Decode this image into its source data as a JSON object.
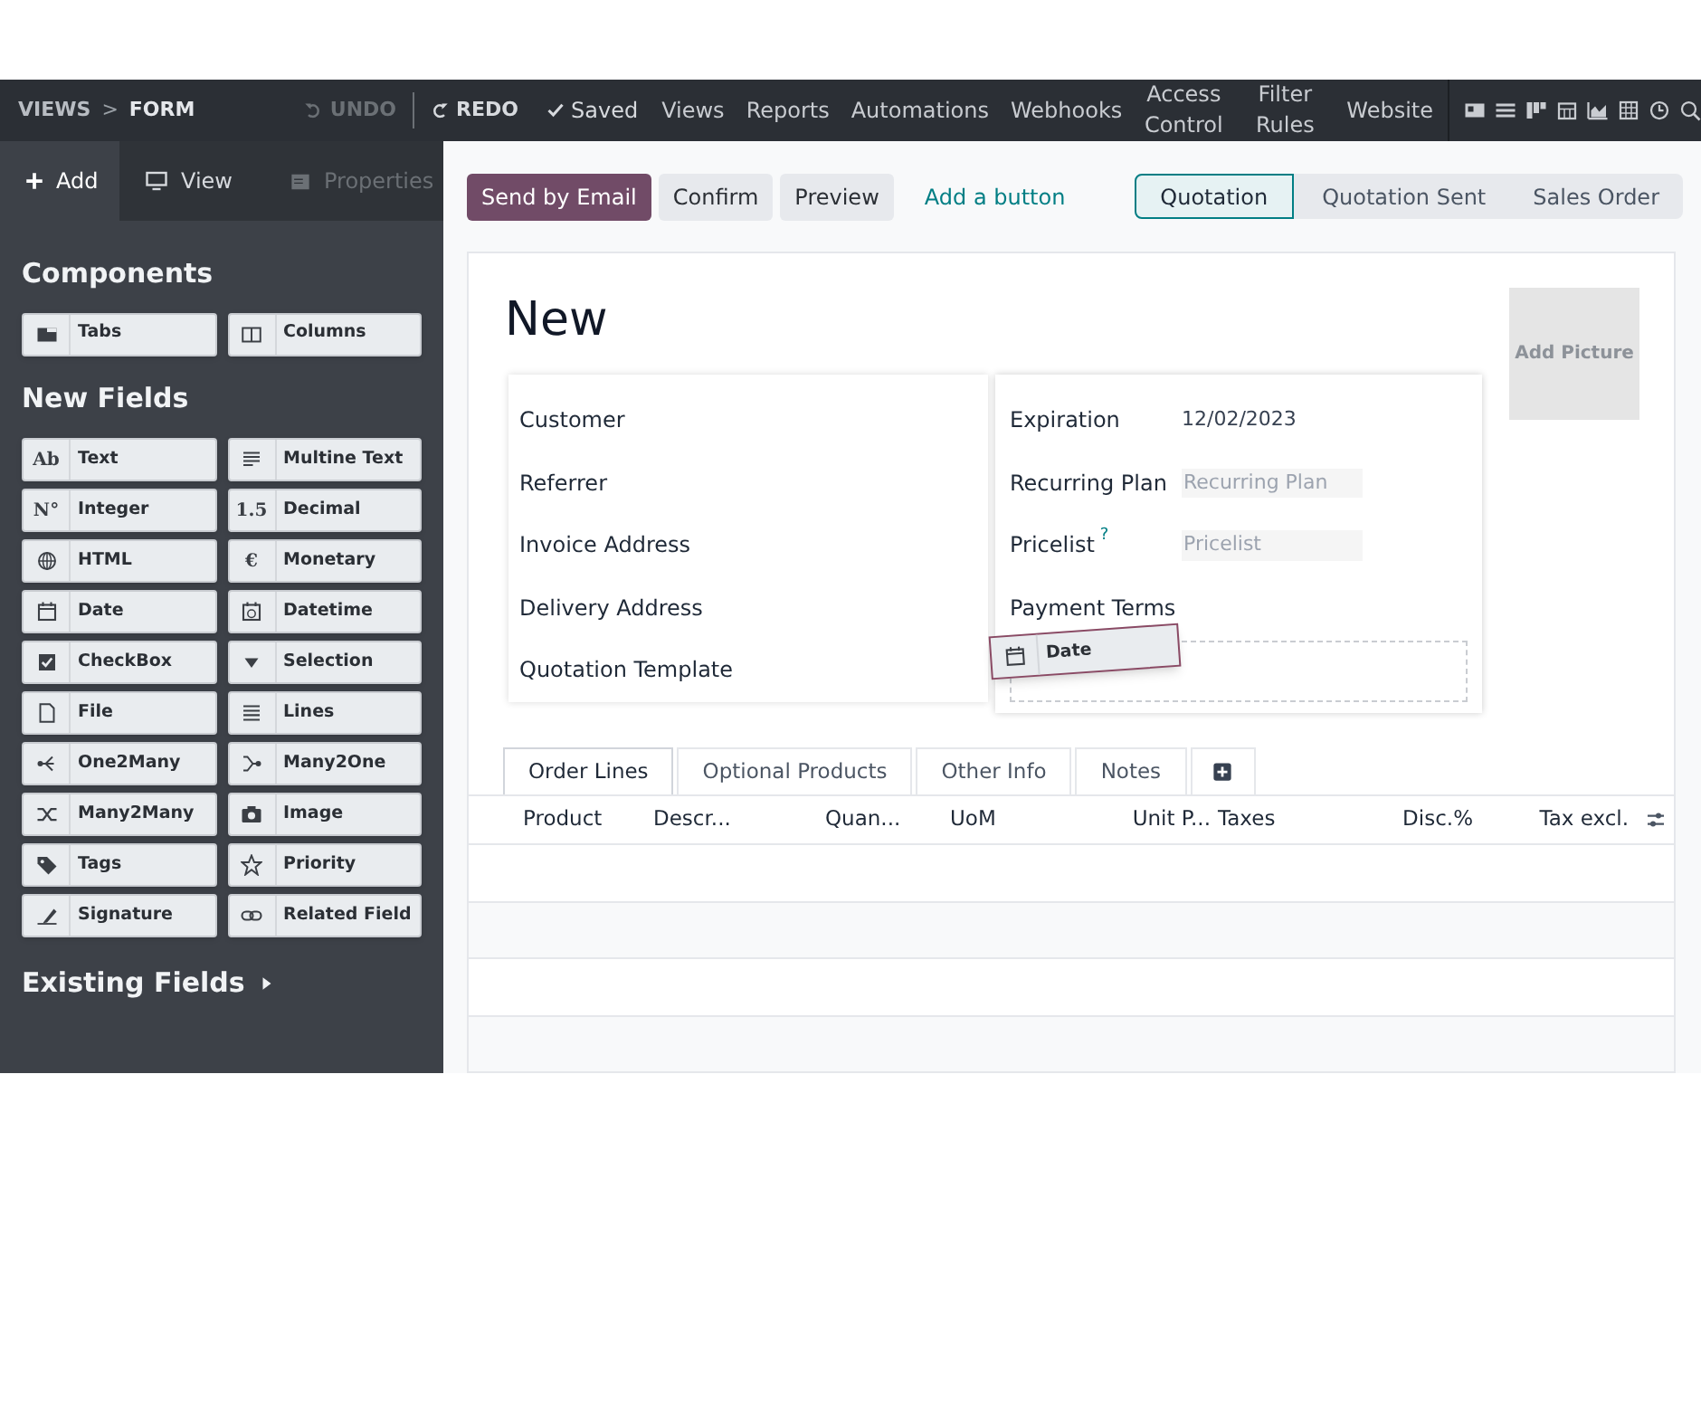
{
  "breadcrumb": {
    "items": [
      "VIEWS",
      "FORM"
    ],
    "separator": ">"
  },
  "history": {
    "undo": {
      "label": "UNDO",
      "disabled": true
    },
    "redo": {
      "label": "REDO",
      "disabled": false
    },
    "saved": "Saved"
  },
  "menu": [
    "Views",
    "Reports",
    "Automations",
    "Webhooks",
    "Access Control",
    "Filter Rules",
    "Website"
  ],
  "sidebar_tabs": [
    {
      "label": "Add",
      "selected": true,
      "disabled": false
    },
    {
      "label": "View",
      "selected": false,
      "disabled": false
    },
    {
      "label": "Properties",
      "selected": false,
      "disabled": true
    }
  ],
  "components": {
    "title": "Components",
    "items": [
      {
        "label": "Tabs"
      },
      {
        "label": "Columns"
      }
    ]
  },
  "new_fields": {
    "title": "New Fields",
    "items": [
      {
        "label": "Text",
        "icon_text": "Ab"
      },
      {
        "label": "Multine Text"
      },
      {
        "label": "Integer",
        "icon_text": "N°"
      },
      {
        "label": "Decimal",
        "icon_text": "1.5"
      },
      {
        "label": "HTML"
      },
      {
        "label": "Monetary",
        "icon_text": "€"
      },
      {
        "label": "Date"
      },
      {
        "label": "Datetime"
      },
      {
        "label": "CheckBox"
      },
      {
        "label": "Selection"
      },
      {
        "label": "File"
      },
      {
        "label": "Lines"
      },
      {
        "label": "One2Many"
      },
      {
        "label": "Many2One"
      },
      {
        "label": "Many2Many"
      },
      {
        "label": "Image"
      },
      {
        "label": "Tags"
      },
      {
        "label": "Priority"
      },
      {
        "label": "Signature"
      },
      {
        "label": "Related Field"
      }
    ]
  },
  "existing_fields": {
    "title": "Existing Fields",
    "expanded": false
  },
  "header_buttons": [
    {
      "label": "Send by Email",
      "kind": "primary"
    },
    {
      "label": "Confirm",
      "kind": "secondary"
    },
    {
      "label": "Preview",
      "kind": "secondary"
    },
    {
      "label": "Add a button",
      "kind": "link"
    }
  ],
  "status_steps": [
    {
      "label": "Quotation",
      "selected": true
    },
    {
      "label": "Quotation Sent",
      "selected": false
    },
    {
      "label": "Sales Order",
      "selected": false
    }
  ],
  "form": {
    "title": "New",
    "add_picture": "Add Picture",
    "left_fields": [
      {
        "label": "Customer"
      },
      {
        "label": "Referrer"
      },
      {
        "label": "Invoice Address"
      },
      {
        "label": "Delivery Address"
      },
      {
        "label": "Quotation Template"
      }
    ],
    "right_fields": [
      {
        "label": "Expiration",
        "value": "12/02/2023"
      },
      {
        "label": "Recurring Plan",
        "placeholder": "Recurring Plan"
      },
      {
        "label": "Pricelist",
        "help": "?",
        "placeholder": "Pricelist"
      },
      {
        "label": "Payment Terms"
      }
    ],
    "dragged_item": {
      "label": "Date"
    }
  },
  "notebook_tabs": [
    {
      "label": "Order Lines",
      "selected": true
    },
    {
      "label": "Optional Products",
      "selected": false
    },
    {
      "label": "Other Info",
      "selected": false
    },
    {
      "label": "Notes",
      "selected": false
    }
  ],
  "table": {
    "columns": [
      "Product",
      "Descr...",
      "Quan...",
      "UoM",
      "Unit P...",
      "Taxes",
      "Disc.%",
      "Tax excl."
    ]
  }
}
